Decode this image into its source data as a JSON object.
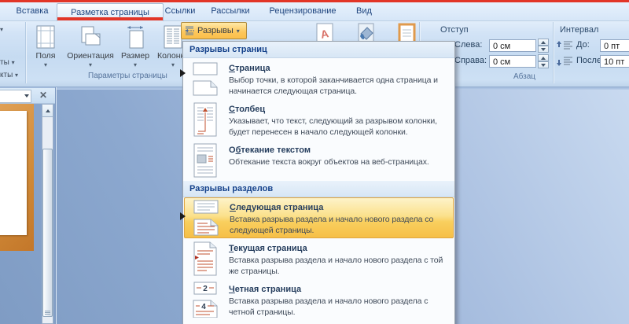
{
  "colors": {
    "annotation_red": "#e23527",
    "breaks_button_highlight": "#fcc65a",
    "menu_item_highlight": "#f9cf5e",
    "accent_navy": "#15428b",
    "document_background": "#97b1d5",
    "thumbnail_orange": "#d08a38"
  },
  "glyphs": {
    "dropdown": "▾",
    "close": "✕"
  },
  "tabs": {
    "insert": "Вставка",
    "layout": "Разметка страницы",
    "references": "Ссылки",
    "mailings": "Рассылки",
    "review": "Рецензирование",
    "view": "Вид"
  },
  "themes_group": {
    "frag_top": "ты",
    "frag_bottom": "кты"
  },
  "page_setup": {
    "group_label": "Параметры страницы",
    "margins": "Поля",
    "orientation": "Ориентация",
    "size": "Размер",
    "columns": "Колонки",
    "breaks": "Разрывы"
  },
  "paragraph_group": {
    "group_label": "Абзац",
    "indent_title": "Отступ",
    "indent_left_label": "Слева:",
    "indent_left_value": "0 см",
    "indent_right_label": "Справа:",
    "indent_right_value": "0 см",
    "spacing_title": "Интервал",
    "spacing_before_label": "До:",
    "spacing_before_value": "0 пт",
    "spacing_after_label": "После:",
    "spacing_after_value": "10 пт"
  },
  "breaks_menu": {
    "header_pages": "Разрывы страниц",
    "header_sections": "Разрывы разделов",
    "items": [
      {
        "pre": "",
        "accel": "С",
        "rest": "траница",
        "desc": "Выбор точки, в которой заканчивается одна страница и начинается следующая страница.",
        "icon": "page-break-icon"
      },
      {
        "pre": "",
        "accel": "С",
        "rest": "толбец",
        "desc": "Указывает, что текст, следующий за разрывом колонки, будет перенесен в начало следующей колонки.",
        "icon": "column-break-icon"
      },
      {
        "pre": "О",
        "accel": "б",
        "rest": "текание текстом",
        "desc": "Обтекание текста вокруг объектов на веб-страницах.",
        "icon": "text-wrap-icon"
      },
      {
        "pre": "",
        "accel": "С",
        "rest": "ледующая страница",
        "desc": "Вставка разрыва раздела и начало нового раздела со следующей страницы.",
        "icon": "next-page-icon"
      },
      {
        "pre": "",
        "accel": "Т",
        "rest": "екущая страница",
        "desc": "Вставка разрыва раздела и начало нового раздела с той же страницы.",
        "icon": "continuous-break-icon"
      },
      {
        "pre": "",
        "accel": "Ч",
        "rest": "етная страница",
        "desc": "Вставка разрыва раздела и начало нового раздела с четной страницы.",
        "icon": "even-page-icon"
      }
    ],
    "even_page_numbers": {
      "first": "2",
      "second": "4"
    }
  }
}
